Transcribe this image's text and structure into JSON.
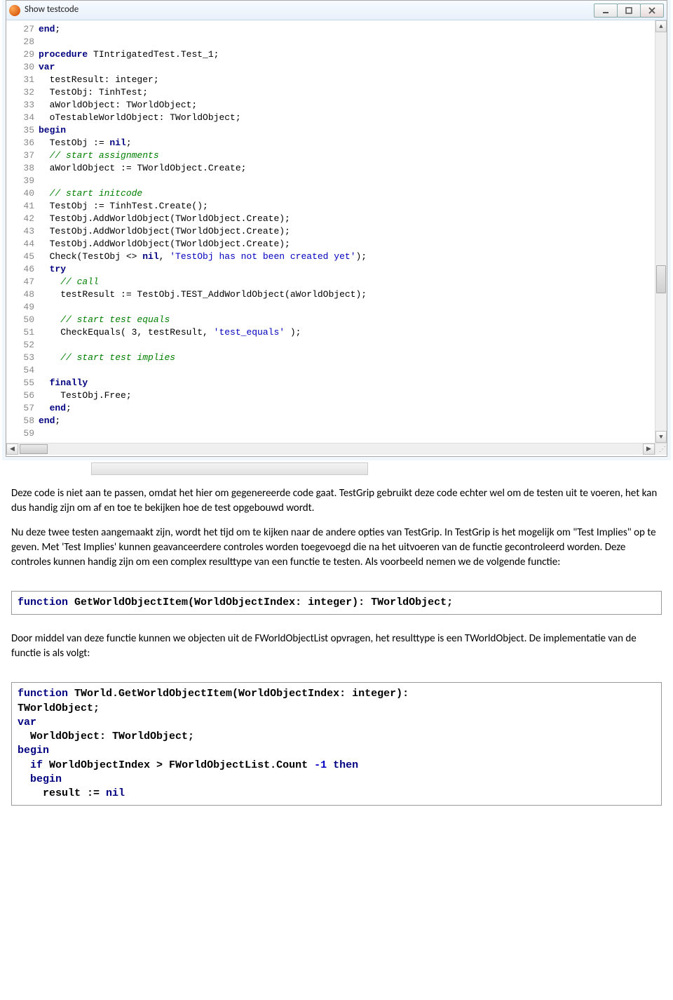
{
  "window": {
    "title": "Show testcode",
    "code_lines": [
      {
        "n": 27,
        "tokens": [
          [
            "kw",
            "end"
          ],
          [
            "",
            ";"
          ]
        ]
      },
      {
        "n": 28,
        "tokens": []
      },
      {
        "n": 29,
        "tokens": [
          [
            "kw",
            "procedure"
          ],
          [
            "",
            " TIntrigatedTest.Test_1;"
          ]
        ]
      },
      {
        "n": 30,
        "tokens": [
          [
            "kw",
            "var"
          ]
        ]
      },
      {
        "n": 31,
        "tokens": [
          [
            "",
            "  testResult: integer;"
          ]
        ]
      },
      {
        "n": 32,
        "tokens": [
          [
            "",
            "  TestObj: TinhTest;"
          ]
        ]
      },
      {
        "n": 33,
        "tokens": [
          [
            "",
            "  aWorldObject: TWorldObject;"
          ]
        ]
      },
      {
        "n": 34,
        "tokens": [
          [
            "",
            "  oTestableWorldObject: TWorldObject;"
          ]
        ]
      },
      {
        "n": 35,
        "tokens": [
          [
            "kw",
            "begin"
          ]
        ]
      },
      {
        "n": 36,
        "tokens": [
          [
            "",
            "  TestObj := "
          ],
          [
            "kw",
            "nil"
          ],
          [
            "",
            ";"
          ]
        ]
      },
      {
        "n": 37,
        "tokens": [
          [
            "",
            "  "
          ],
          [
            "cmt",
            "// start assignments"
          ]
        ]
      },
      {
        "n": 38,
        "tokens": [
          [
            "",
            "  aWorldObject := TWorldObject.Create;"
          ]
        ]
      },
      {
        "n": 39,
        "tokens": []
      },
      {
        "n": 40,
        "tokens": [
          [
            "",
            "  "
          ],
          [
            "cmt",
            "// start initcode"
          ]
        ]
      },
      {
        "n": 41,
        "tokens": [
          [
            "",
            "  TestObj := TinhTest.Create();"
          ]
        ]
      },
      {
        "n": 42,
        "tokens": [
          [
            "",
            "  TestObj.AddWorldObject(TWorldObject.Create);"
          ]
        ]
      },
      {
        "n": 43,
        "tokens": [
          [
            "",
            "  TestObj.AddWorldObject(TWorldObject.Create);"
          ]
        ]
      },
      {
        "n": 44,
        "tokens": [
          [
            "",
            "  TestObj.AddWorldObject(TWorldObject.Create);"
          ]
        ]
      },
      {
        "n": 45,
        "tokens": [
          [
            "",
            "  Check(TestObj <> "
          ],
          [
            "kw",
            "nil"
          ],
          [
            "",
            ", "
          ],
          [
            "str",
            "'TestObj has not been created yet'"
          ],
          [
            "",
            ");"
          ]
        ]
      },
      {
        "n": 46,
        "tokens": [
          [
            "",
            "  "
          ],
          [
            "kw",
            "try"
          ]
        ]
      },
      {
        "n": 47,
        "tokens": [
          [
            "",
            "    "
          ],
          [
            "cmt",
            "// call"
          ]
        ]
      },
      {
        "n": 48,
        "tokens": [
          [
            "",
            "    testResult := TestObj.TEST_AddWorldObject(aWorldObject);"
          ]
        ]
      },
      {
        "n": 49,
        "tokens": []
      },
      {
        "n": 50,
        "tokens": [
          [
            "",
            "    "
          ],
          [
            "cmt",
            "// start test equals"
          ]
        ]
      },
      {
        "n": 51,
        "tokens": [
          [
            "",
            "    CheckEquals( 3, testResult, "
          ],
          [
            "str",
            "'test_equals'"
          ],
          [
            "",
            " );"
          ]
        ]
      },
      {
        "n": 52,
        "tokens": []
      },
      {
        "n": 53,
        "tokens": [
          [
            "",
            "    "
          ],
          [
            "cmt",
            "// start test implies"
          ]
        ]
      },
      {
        "n": 54,
        "tokens": []
      },
      {
        "n": 55,
        "tokens": [
          [
            "",
            "  "
          ],
          [
            "kw",
            "finally"
          ]
        ]
      },
      {
        "n": 56,
        "tokens": [
          [
            "",
            "    TestObj.Free;"
          ]
        ]
      },
      {
        "n": 57,
        "tokens": [
          [
            "",
            "  "
          ],
          [
            "kw",
            "end"
          ],
          [
            "",
            ";"
          ]
        ]
      },
      {
        "n": 58,
        "tokens": [
          [
            "kw",
            "end"
          ],
          [
            "",
            ";"
          ]
        ]
      },
      {
        "n": 59,
        "tokens": []
      }
    ]
  },
  "paragraphs": {
    "p1": "Deze code is niet aan te passen, omdat het hier om gegenereerde code gaat. TestGrip gebruikt deze code echter wel om de testen uit te voeren, het kan dus handig zijn om af en toe te bekijken hoe de test opgebouwd wordt.",
    "p2": "Nu deze twee testen aangemaakt zijn, wordt het tijd om te kijken naar de andere opties van TestGrip. In TestGrip is het mogelijk om \"Test Implies\" op te geven. Met 'Test Implies' kunnen geavanceerdere controles worden toegevoegd die na het uitvoeren van de functie gecontroleerd worden. Deze controles kunnen handig zijn om een complex resulttype van een functie te testen. Als voorbeeld nemen we de volgende functie:",
    "p3": "Door middel van deze functie kunnen we objecten uit de FWorldObjectList opvragen, het resulttype is een TWorldObject. De implementatie van de functie is als volgt:"
  },
  "codebox1": {
    "tokens": [
      [
        "kw2",
        "function"
      ],
      [
        "",
        " GetWorldObjectItem(WorldObjectIndex: integer): TWorldObject;"
      ]
    ]
  },
  "codebox2": {
    "lines": [
      [
        [
          "kw2",
          "function"
        ],
        [
          "",
          " TWorld.GetWorldObjectItem(WorldObjectIndex: integer): "
        ]
      ],
      [
        [
          "",
          "TWorldObject;"
        ]
      ],
      [
        [
          "kw2",
          "var"
        ]
      ],
      [
        [
          "",
          "  WorldObject: TWorldObject;"
        ]
      ],
      [
        [
          "kw2",
          "begin"
        ]
      ],
      [
        [
          "",
          "  "
        ],
        [
          "kw2",
          "if"
        ],
        [
          "",
          " WorldObjectIndex > FWorldObjectList.Count "
        ],
        [
          "num",
          "-1"
        ],
        [
          "",
          " "
        ],
        [
          "kw2",
          "then"
        ]
      ],
      [
        [
          "",
          "  "
        ],
        [
          "kw2",
          "begin"
        ]
      ],
      [
        [
          "",
          "    result := "
        ],
        [
          "kw2",
          "nil"
        ]
      ]
    ]
  }
}
